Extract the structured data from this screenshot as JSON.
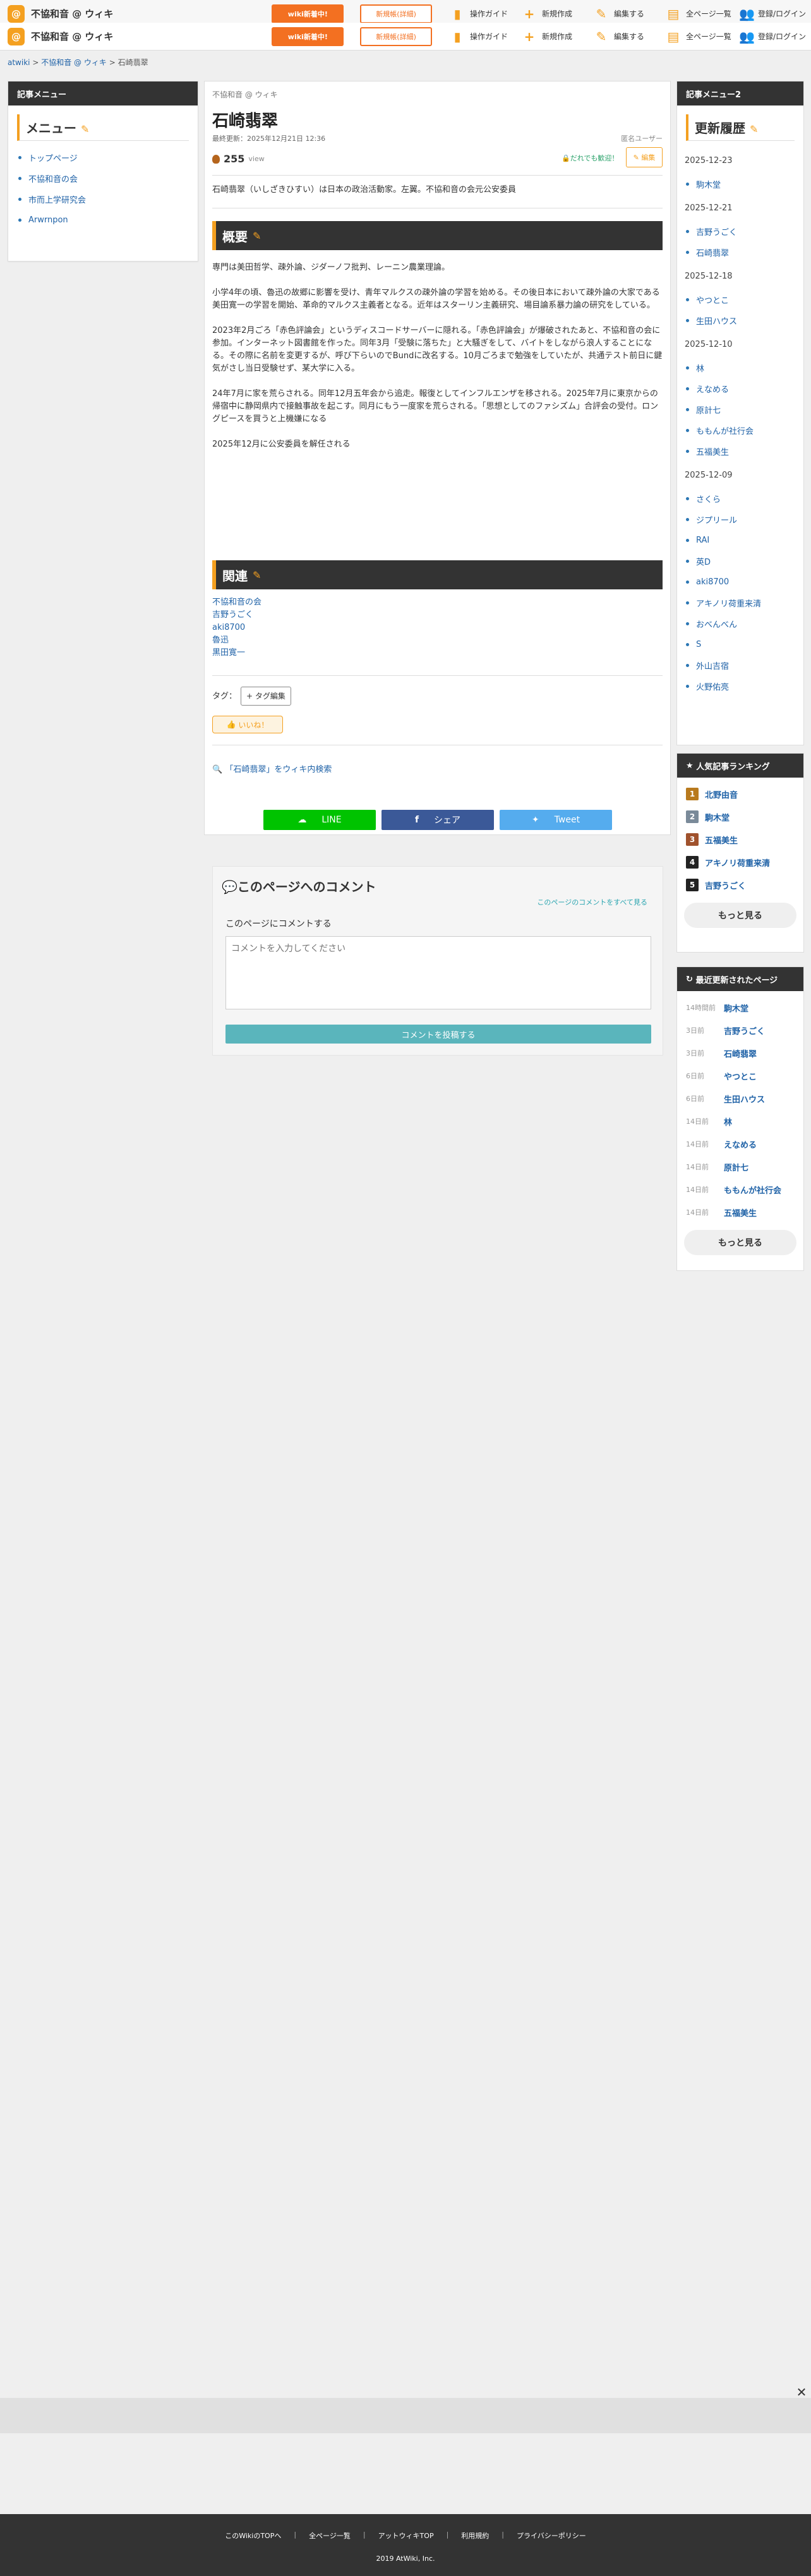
{
  "header": {
    "site_title": "不協和音 @ ウィキ",
    "wiki_button": "wiki新着中!",
    "free_button": "新規帳(詳細)",
    "nav": [
      {
        "icon": "guide-icon",
        "glyph": "▮",
        "label": "操作ガイド"
      },
      {
        "icon": "plus-icon",
        "glyph": "+",
        "label": "新規作成"
      },
      {
        "icon": "pencil-icon",
        "glyph": "✎",
        "label": "編集する"
      },
      {
        "icon": "pages-icon",
        "glyph": "▤",
        "label": "全ページ一覧"
      },
      {
        "icon": "users-icon",
        "glyph": "👥",
        "label": "登録/ログイン"
      }
    ]
  },
  "breadcrumb": {
    "items": [
      "atwiki",
      "不協和音 @ ウィキ",
      "石崎翡翠"
    ],
    "sep": ">"
  },
  "left": {
    "box_title": "記事メニュー",
    "menu_title": "メニュー",
    "items": [
      "トップページ",
      "不協和音の会",
      "市而上学研究会",
      "Arwrnpon"
    ]
  },
  "main": {
    "site_name": "不協和音 @ ウィキ",
    "title": "石崎翡翠",
    "updated": "最終更新：2025年12月21日 12:36",
    "author": "匿名ユーザー",
    "views": "255",
    "views_unit": "view",
    "anyone": "だれでも歓迎！",
    "edit": "編集",
    "intro": "石崎翡翠（いしざきひすい）は日本の政治活動家。左翼。不協和音の会元公安委員",
    "h_summary": "概要",
    "p1": "専門は美田哲学、疎外論、ジダーノフ批判、レーニン農業理論。",
    "p2": "小学4年の頃、魯迅の故郷に影響を受け、青年マルクスの疎外論の学習を始める。その後日本において疎外論の大家である美田寛一の学習を開始、革命的マルクス主義者となる。近年はスターリン主義研究、場目論系暴力論の研究をしている。",
    "p3": "2023年2月ごろ「赤色評論会」というディスコードサーバーに隠れる。「赤色評論会」が爆破されたあと、不協和音の会に参加。インターネット図書館を作った。同年3月「受験に落ちた」と大騒ぎをして、バイトをしながら浪人することになる。その際に名前を変更するが、呼び下らいのでBundに改名する。10月ごろまで勉強をしていたが、共通テスト前日に鍵気がさし当日受験せず、某大学に入る。",
    "p4": "24年7月に家を荒らされる。同年12月五年会から追走。報復としてインフルエンザを移される。2025年7月に東京からの帰宿中に静岡県内で接触事故を起こす。同月にもう一度家を荒らされる。「思想としてのファシズム」合評会の受付。ロングピースを買うと上機嫌になる",
    "p5": "2025年12月に公安委員を解任される",
    "h_related": "関連",
    "related": [
      "不協和音の会",
      "吉野うごく",
      "aki8700",
      "魯迅",
      "黒田寛一"
    ],
    "tag_label": "タグ：",
    "tag_button": "+ タグ編集",
    "like": "いいね！",
    "search_link": "「石崎翡翠」をウィキ内検索",
    "share": {
      "line": "LINE",
      "facebook": "シェア",
      "twitter": "Tweet"
    }
  },
  "comment": {
    "title": "このページへのコメント",
    "all_link": "このページのコメントをすべて見る",
    "label": "このページにコメントする",
    "placeholder": "コメントを入力してください",
    "post": "コメントを投稿する"
  },
  "right": {
    "box_title": "記事メニュー2",
    "history_title": "更新履歴",
    "groups": [
      {
        "date": "2025-12-23",
        "items": [
          "駒木堂"
        ]
      },
      {
        "date": "2025-12-21",
        "items": [
          "吉野うごく",
          "石崎翡翠"
        ]
      },
      {
        "date": "2025-12-18",
        "items": [
          "やつとこ",
          "生田ハウス"
        ]
      },
      {
        "date": "2025-12-10",
        "items": [
          "林",
          "えなめる",
          "原計七",
          "ももんが社行会",
          "五福美生"
        ]
      },
      {
        "date": "2025-12-09",
        "items": [
          "さくら",
          "ジプリール",
          "RAI",
          "英D",
          "aki8700",
          "アキノリ荷重来清",
          "おべんべん",
          "S",
          "外山吉宿",
          "火野佑亮"
        ]
      }
    ],
    "ranking_title": "人気記事ランキング",
    "ranking": [
      {
        "n": "1",
        "name": "北野由音",
        "color": "#b87a1e"
      },
      {
        "n": "2",
        "name": "駒木堂",
        "color": "#7a8a99"
      },
      {
        "n": "3",
        "name": "五福美生",
        "color": "#a0522d"
      },
      {
        "n": "4",
        "name": "アキノリ荷重来清",
        "color": "#222222"
      },
      {
        "n": "5",
        "name": "吉野うごく",
        "color": "#222222"
      }
    ],
    "more": "もっと見る",
    "recent_title": "最近更新されたページ",
    "recent": [
      {
        "t": "14時間前",
        "name": "駒木堂"
      },
      {
        "t": "3日前",
        "name": "吉野うごく"
      },
      {
        "t": "3日前",
        "name": "石崎翡翠"
      },
      {
        "t": "6日前",
        "name": "やつとこ"
      },
      {
        "t": "6日前",
        "name": "生田ハウス"
      },
      {
        "t": "14日前",
        "name": "林"
      },
      {
        "t": "14日前",
        "name": "えなめる"
      },
      {
        "t": "14日前",
        "name": "原計七"
      },
      {
        "t": "14日前",
        "name": "ももんが社行会"
      },
      {
        "t": "14日前",
        "name": "五福美生"
      }
    ]
  },
  "footer": {
    "links": [
      "このWikiのTOPへ",
      "全ページ一覧",
      "アットウィキTOP",
      "利用規約",
      "プライバシーポリシー"
    ],
    "copyright": "2019 AtWiki, Inc."
  },
  "colors": {
    "accent": "#f4a020",
    "dark": "#333333",
    "link": "#1f62a7",
    "line": "#00c300",
    "facebook": "#3b5998",
    "twitter": "#55acee"
  }
}
